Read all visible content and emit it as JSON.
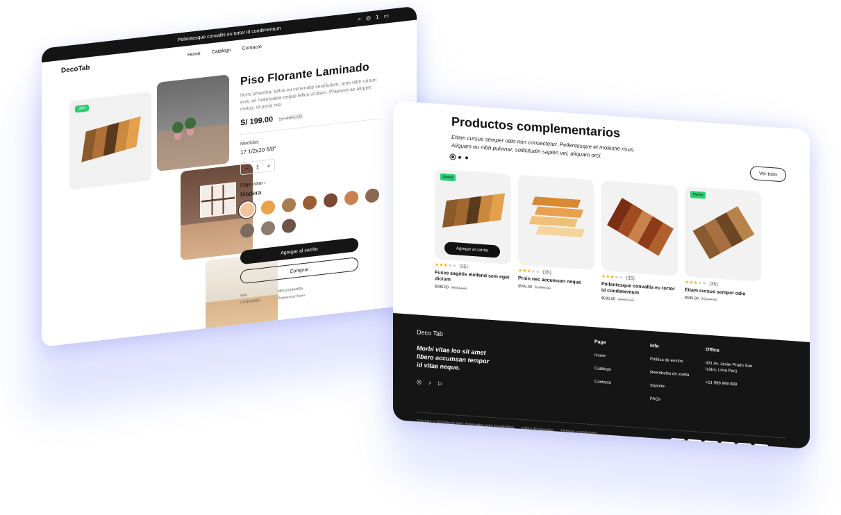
{
  "left_card": {
    "announcement": "Pellentesque convallis eu tortor id condimentum",
    "header_icons": {
      "search": "search-icon",
      "account": "user-icon",
      "cart_count": "1",
      "cart": "bag-icon"
    },
    "logo": "DecoTab",
    "nav": [
      "Home",
      "Catálogo",
      "Contacto"
    ],
    "discount_badge": "-30%",
    "product": {
      "title": "Piso Florante Laminado",
      "description": "Nunc pharetra, tellus eu venenatis vestibulum, ante nibh rutrum erat, ac malesuada neque tellus ut diam. Praesent ac aliquet metus, id porta nisi.",
      "price": "S/ 199.00",
      "old_price": "S/ 400.00",
      "measures_label": "Medidas",
      "measures_value": "17 1/2x20 5/8\"",
      "qty_minus": "−",
      "qty_value": "1",
      "qty_plus": "+",
      "color_label": "Elige color",
      "color_chevron": "›",
      "color_name": "Madera",
      "swatches": [
        "#f4c39a",
        "#e8a24a",
        "#a67c52",
        "#9b5e33",
        "#7a4a32",
        "#c98154",
        "#8a6a50",
        "#7a6a60",
        "#8b7d70",
        "#6e5448"
      ],
      "add_to_cart": "Agregar al carrito",
      "buy": "Comprar",
      "sku_label": "SKU",
      "sku_value": "MED232344005",
      "category_label": "CATEGORÍA",
      "category_value": "Praesent et fluero"
    }
  },
  "right_card": {
    "title": "Productos complementarios",
    "subtitle": "Etiam cursus semper odio non consectetur. Pellentesque et molestie risus. Aliquam eu nibh pulvinar, sollicitudin sapien vel, aliquam orci.",
    "view_all": "Ver todo",
    "badge_new": "Nuevo",
    "add_to_cart": "Agregar al carrito",
    "products": [
      {
        "name": "Fusce sagittis eleifend sem eget dictum",
        "reviews": "(35)",
        "rating": 3,
        "price": "$595.00",
        "old_price": "$1000.00",
        "badge": true
      },
      {
        "name": "Proin nec accumsan neque",
        "reviews": "(35)",
        "rating": 3,
        "price": "$595.00",
        "old_price": "$1000.00",
        "badge": false
      },
      {
        "name": "Pellentesque convallis eu tortor id condimentum",
        "reviews": "(35)",
        "rating": 3,
        "price": "$595.00",
        "old_price": "$1000.00",
        "badge": false
      },
      {
        "name": "Etiam cursus semper odio",
        "reviews": "(35)",
        "rating": 3,
        "price": "$595.00",
        "old_price": "$1000.00",
        "badge": true
      }
    ],
    "footer": {
      "brand": "Deco Tab",
      "tagline": "Morbi vitae leo sit amet libero accumsan tempor id vitae neque.",
      "social_icons": [
        "instagram-icon",
        "tiktok-icon",
        "youtube-icon"
      ],
      "page_heading": "Page",
      "page_links": [
        "Home",
        "Catálogo",
        "Contacto"
      ],
      "info_heading": "Info",
      "info_links": [
        "Política de envíos",
        "Reembolso de vuelta",
        "Soporte",
        "FAQs"
      ],
      "office_heading": "Office",
      "office_address": "431 Av. Javier Prado San Isidro, Lima Perú",
      "office_phone": "+51 999 999 999",
      "copyright": "Copyright © 2023 Mundo Web. Reservados todos los derechos",
      "privacy": "política de privacidad",
      "terms": "Términos y condiciones",
      "payments": [
        "VISA",
        "AMEX",
        "MC",
        "stripe",
        "PayPal",
        "Pay"
      ]
    }
  }
}
